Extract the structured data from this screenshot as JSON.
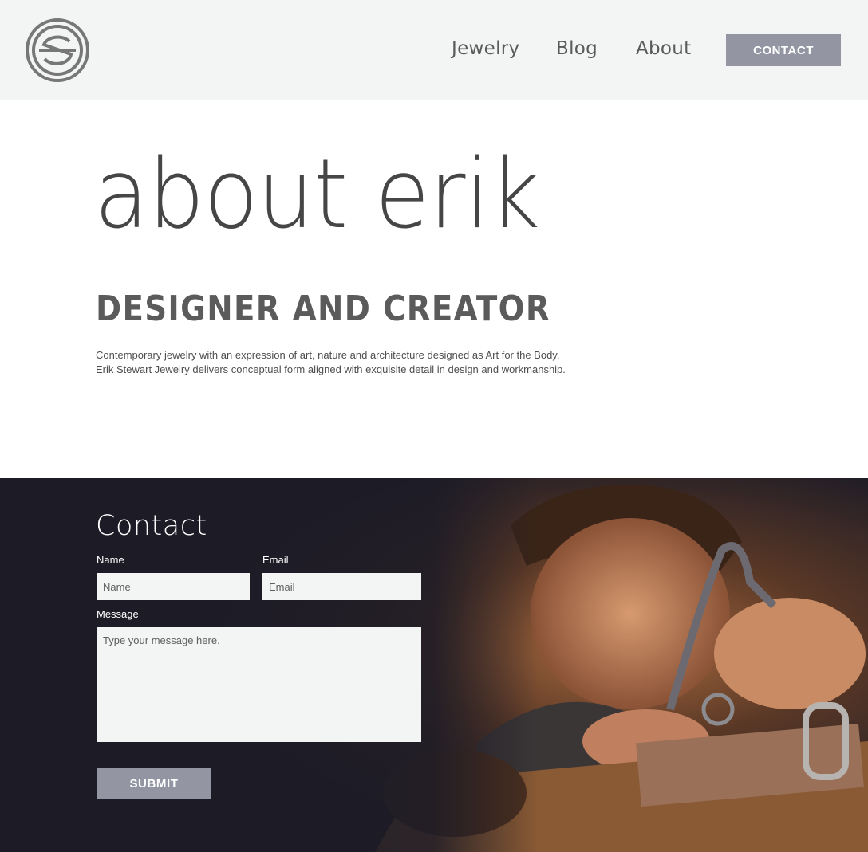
{
  "header": {
    "logo_icon": "es-monogram-logo",
    "nav": [
      {
        "label": "Jewelry"
      },
      {
        "label": "Blog"
      },
      {
        "label": "About"
      }
    ],
    "contact_label": "CONTACT"
  },
  "hero": {
    "title": "about erik",
    "subtitle": "DESIGNER AND CREATOR",
    "bio": "Contemporary jewelry with an expression of art, nature and architecture designed as Art for the Body. Erik Stewart Jewelry delivers conceptual form aligned with exquisite detail in design and workmanship."
  },
  "contact": {
    "title": "Contact",
    "name_label": "Name",
    "name_placeholder": "Name",
    "email_label": "Email",
    "email_placeholder": "Email",
    "message_label": "Message",
    "message_placeholder": "Type your message here.",
    "submit_label": "SUBMIT"
  },
  "colors": {
    "header_bg": "#f3f4f4",
    "button_bg": "#9395a3",
    "contact_bg": "#1c1b26"
  }
}
